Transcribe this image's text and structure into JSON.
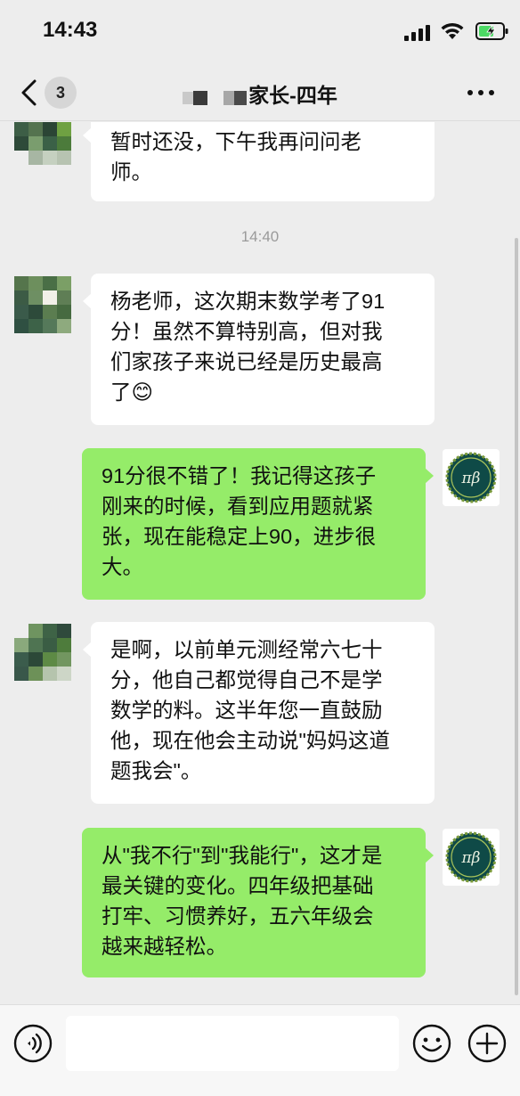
{
  "status_bar": {
    "time": "14:43"
  },
  "nav": {
    "back_count": "3",
    "title": "家长-四年"
  },
  "messages": [
    {
      "side": "in",
      "text": "暂时还没，下午我再问问老师。"
    },
    {
      "type": "time",
      "text": "14:40"
    },
    {
      "side": "in",
      "text": "杨老师，这次期末数学考了91分！虽然不算特别高，但对我们家孩子来说已经是历史最高了😊"
    },
    {
      "side": "out",
      "text": "91分很不错了！我记得这孩子刚来的时候，看到应用题就紧张，现在能稳定上90，进步很大。"
    },
    {
      "side": "in",
      "text": "是啊，以前单元测经常六七十分，他自己都觉得自己不是学数学的料。这半年您一直鼓励他，现在他会主动说\"妈妈这道题我会\"。"
    },
    {
      "side": "out",
      "text": "从\"我不行\"到\"我能行\"，这才是最关键的变化。四年级把基础打牢、习惯养好，五六年级会越来越轻松。"
    }
  ],
  "msg_lines": {
    "m0": [
      "暂时还没，下午我再问问老",
      "师。"
    ],
    "m2": [
      "杨老师，这次期末数学考了91",
      "分！虽然不算特别高，但对我",
      "们家孩子来说已经是历史最高",
      "了😊"
    ],
    "m3": [
      "91分很不错了！我记得这孩子",
      "刚来的时候，看到应用题就紧",
      "张，现在能稳定上90，进步很",
      "大。"
    ],
    "m4": [
      "是啊，以前单元测经常六七十",
      "分，他自己都觉得自己不是学",
      "数学的料。这半年您一直鼓励",
      "他，现在他会主动说\"妈妈这道",
      "题我会\"。"
    ],
    "m5": [
      "从\"我不行\"到\"我能行\"，这才是",
      "最关键的变化。四年级把基础",
      "打牢、习惯养好，五六年级会",
      "越来越轻松。"
    ]
  },
  "avatars": {
    "teacher_logo": "πβ"
  },
  "icons": {
    "back": "chevron-left-icon",
    "more": "more-dots-icon",
    "voice": "voice-icon",
    "emoji": "emoji-icon",
    "plus": "plus-icon"
  },
  "colors": {
    "outgoing_bubble": "#95ec69",
    "incoming_bubble": "#ffffff",
    "background": "#ededed"
  }
}
